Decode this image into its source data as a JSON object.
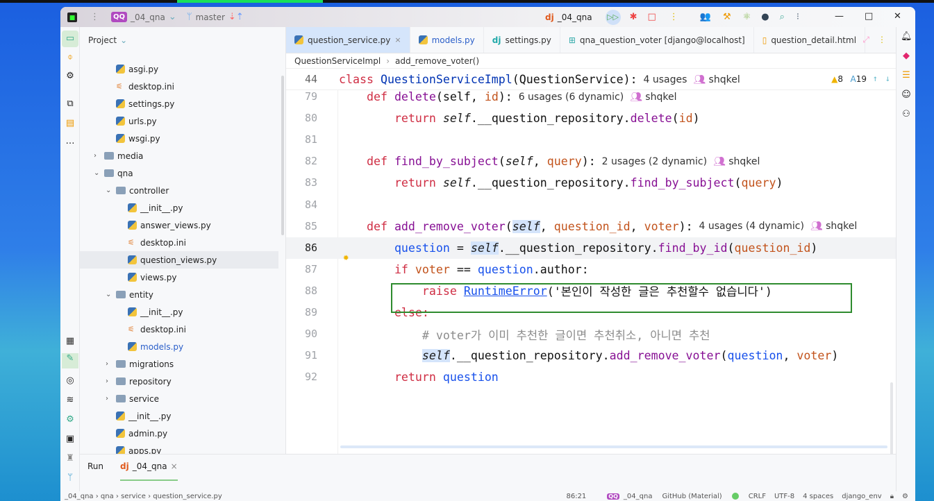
{
  "titlebar": {
    "project_badge": "QQ",
    "project": "_04_qna",
    "branch": "master",
    "run_config": "_04_qna"
  },
  "project_panel": {
    "title": "Project",
    "items": [
      {
        "label": "asgi.py",
        "type": "py",
        "level": 3
      },
      {
        "label": "desktop.ini",
        "type": "cfg",
        "level": 3
      },
      {
        "label": "settings.py",
        "type": "py",
        "level": 3
      },
      {
        "label": "urls.py",
        "type": "py",
        "level": 3
      },
      {
        "label": "wsgi.py",
        "type": "py",
        "level": 3
      },
      {
        "label": "media",
        "type": "folder",
        "level": 2,
        "arrow": "›"
      },
      {
        "label": "qna",
        "type": "folder",
        "level": 2,
        "arrow": "⌄"
      },
      {
        "label": "controller",
        "type": "folder",
        "level": 3,
        "arrow": "⌄"
      },
      {
        "label": "__init__.py",
        "type": "py",
        "level": 4
      },
      {
        "label": "answer_views.py",
        "type": "py",
        "level": 4
      },
      {
        "label": "desktop.ini",
        "type": "cfg",
        "level": 4
      },
      {
        "label": "question_views.py",
        "type": "py",
        "level": 4,
        "selected": true
      },
      {
        "label": "views.py",
        "type": "py",
        "level": 4
      },
      {
        "label": "entity",
        "type": "folder",
        "level": 3,
        "arrow": "⌄"
      },
      {
        "label": "__init__.py",
        "type": "py",
        "level": 4
      },
      {
        "label": "desktop.ini",
        "type": "cfg",
        "level": 4
      },
      {
        "label": "models.py",
        "type": "py",
        "level": 4,
        "blue": true
      },
      {
        "label": "migrations",
        "type": "folder",
        "level": 3,
        "arrow": "›"
      },
      {
        "label": "repository",
        "type": "folder",
        "level": 3,
        "arrow": "›"
      },
      {
        "label": "service",
        "type": "folder",
        "level": 3,
        "arrow": "›"
      },
      {
        "label": "__init__.py",
        "type": "py",
        "level": 3
      },
      {
        "label": "admin.py",
        "type": "py",
        "level": 3
      },
      {
        "label": "apps.py",
        "type": "py",
        "level": 3
      }
    ]
  },
  "tabs": [
    {
      "label": "question_service.py",
      "active": true,
      "close": "×"
    },
    {
      "label": "models.py"
    },
    {
      "label": "settings.py"
    },
    {
      "label": "qna_question_voter [django@localhost]"
    },
    {
      "label": "question_detail.html"
    }
  ],
  "breadcrumb": [
    "QuestionServiceImpl",
    "add_remove_voter()"
  ],
  "inspections": {
    "warnings": "8",
    "typos": "19"
  },
  "code": {
    "sticky": {
      "num": "44",
      "tokens": [
        [
          "class ",
          "kw"
        ],
        [
          "QuestionServiceImpl",
          "cls"
        ],
        [
          "(QuestionService):",
          "pl"
        ],
        [
          "  4 usages  ",
          "hint"
        ],
        [
          "👥 shqkel",
          "hint"
        ]
      ]
    },
    "lines": [
      {
        "num": "79",
        "tokens": [
          [
            "    "
          ],
          [
            "def ",
            "kw"
          ],
          [
            "delete",
            "fn"
          ],
          [
            "(self, ",
            "pl"
          ],
          [
            "id",
            "pa"
          ],
          [
            "):",
            "pl"
          ],
          [
            "  6 usages (6 dynamic)  ",
            "hint"
          ],
          [
            "👥 shqkel",
            "hint"
          ]
        ]
      },
      {
        "num": "80",
        "tokens": [
          [
            "        "
          ],
          [
            "return ",
            "kw"
          ],
          [
            "self",
            "se"
          ],
          [
            ".__question_repository.",
            "pl"
          ],
          [
            "delete",
            "fn"
          ],
          [
            "(",
            "pl"
          ],
          [
            "id",
            "pa"
          ],
          [
            ")",
            "pl"
          ]
        ]
      },
      {
        "num": "81",
        "tokens": []
      },
      {
        "num": "82",
        "tokens": [
          [
            "    "
          ],
          [
            "def ",
            "kw"
          ],
          [
            "find_by_subject",
            "fn"
          ],
          [
            "(",
            "pl"
          ],
          [
            "self",
            "se"
          ],
          [
            ", ",
            "pl"
          ],
          [
            "query",
            "pa"
          ],
          [
            "):",
            "pl"
          ],
          [
            "  2 usages (2 dynamic)  ",
            "hint"
          ],
          [
            "👥 shqkel",
            "hint"
          ]
        ]
      },
      {
        "num": "83",
        "tokens": [
          [
            "        "
          ],
          [
            "return ",
            "kw"
          ],
          [
            "self",
            "se"
          ],
          [
            ".__question_repository.",
            "pl"
          ],
          [
            "find_by_subject",
            "fn"
          ],
          [
            "(",
            "pl"
          ],
          [
            "query",
            "pa"
          ],
          [
            ")",
            "pl"
          ]
        ]
      },
      {
        "num": "84",
        "tokens": []
      },
      {
        "num": "85",
        "tokens": [
          [
            "    "
          ],
          [
            "def ",
            "kw"
          ],
          [
            "add_remove_voter",
            "fn"
          ],
          [
            "(",
            "pl"
          ],
          [
            "self",
            "se hl"
          ],
          [
            ", ",
            "pl"
          ],
          [
            "question_id",
            "pa"
          ],
          [
            ", ",
            "pl"
          ],
          [
            "voter",
            "pa"
          ],
          [
            "):",
            "pl"
          ],
          [
            "  4 usages (4 dynamic)  ",
            "hint"
          ],
          [
            "👥 shqkel",
            "hint"
          ]
        ]
      },
      {
        "num": "86",
        "tokens": [
          [
            "        "
          ],
          [
            "question",
            "id"
          ],
          [
            " = ",
            "pl"
          ],
          [
            "self",
            "se hl"
          ],
          [
            ".__question_repository.",
            "pl"
          ],
          [
            "find_by_id",
            "fn"
          ],
          [
            "(",
            "pl"
          ],
          [
            "question_id",
            "pa"
          ],
          [
            ")",
            "pl"
          ]
        ],
        "current": true
      },
      {
        "num": "87",
        "tokens": [
          [
            "        "
          ],
          [
            "if ",
            "kw"
          ],
          [
            "voter",
            "pa"
          ],
          [
            " == ",
            "pl"
          ],
          [
            "question",
            "id"
          ],
          [
            ".author:",
            "pl"
          ]
        ]
      },
      {
        "num": "88",
        "tokens": [
          [
            "            "
          ],
          [
            "raise ",
            "kw"
          ],
          [
            "RuntimeError",
            "cl"
          ],
          [
            "('본인이 작성한 글은 추천할수 없습니다')",
            "st"
          ]
        ]
      },
      {
        "num": "89",
        "tokens": [
          [
            "        "
          ],
          [
            "else:",
            "kw"
          ]
        ]
      },
      {
        "num": "90",
        "tokens": [
          [
            "            "
          ],
          [
            "# voter가 이미 추천한 글이면 추천취소, 아니면 추천",
            "cm"
          ]
        ]
      },
      {
        "num": "91",
        "tokens": [
          [
            "            "
          ],
          [
            "self",
            "se hl"
          ],
          [
            ".__question_repository.",
            "pl"
          ],
          [
            "add_remove_voter",
            "fn"
          ],
          [
            "(",
            "pl"
          ],
          [
            "question",
            "id"
          ],
          [
            ", ",
            "pl"
          ],
          [
            "voter",
            "pa"
          ],
          [
            ")",
            "pl"
          ]
        ]
      },
      {
        "num": "92",
        "tokens": [
          [
            "        "
          ],
          [
            "return ",
            "kw"
          ],
          [
            "question",
            "id"
          ]
        ]
      }
    ]
  },
  "run_panel": {
    "title": "Run",
    "tab": "_04_qna",
    "close": "×"
  },
  "status": {
    "path": [
      "_04_qna",
      "qna",
      "service",
      "question_service.py"
    ],
    "position": "86:21",
    "project_badge": "QQ",
    "project": "_04_qna",
    "theme": "GitHub (Material)",
    "line_sep": "CRLF",
    "encoding": "UTF-8",
    "indent": "4 spaces",
    "interpreter": "django_env"
  }
}
